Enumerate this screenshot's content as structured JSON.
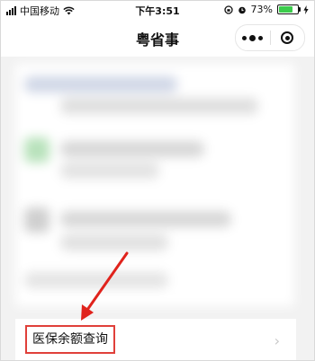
{
  "status_bar": {
    "carrier": "中国移动",
    "time": "下午3:51",
    "battery_percent": "73%",
    "battery_level": 0.73
  },
  "nav": {
    "title": "粤省事"
  },
  "list": {
    "item_label": "医保余额查询"
  },
  "colors": {
    "highlight_border": "#e0403a",
    "arrow": "#e0231c",
    "battery_fill": "#3ccc4c"
  },
  "icons": [
    "wifi-icon",
    "alarm-icon",
    "orientation-lock-icon",
    "battery-icon",
    "charging-icon",
    "more-icon",
    "close-mini-program-icon",
    "chevron-right-icon"
  ]
}
